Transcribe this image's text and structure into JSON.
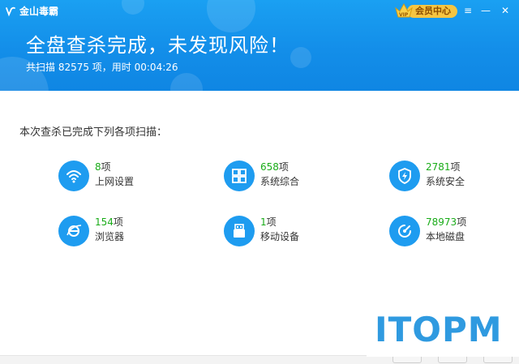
{
  "app": {
    "title": "金山毒霸"
  },
  "header": {
    "vip_label": "会员中心",
    "headline": "全盘查杀完成，未发现风险！",
    "summary": "共扫描 82575 项，用时 00:04:26"
  },
  "window_controls": {
    "menu": "≡",
    "minimize": "—",
    "close": "✕"
  },
  "main": {
    "section_title": "本次查杀已完成下列各项扫描：",
    "items": [
      {
        "count": "8",
        "unit": "项",
        "label": "上网设置",
        "icon": "wifi-icon"
      },
      {
        "count": "658",
        "unit": "项",
        "label": "系统综合",
        "icon": "grid-icon"
      },
      {
        "count": "2781",
        "unit": "项",
        "label": "系统安全",
        "icon": "shield-icon"
      },
      {
        "count": "154",
        "unit": "项",
        "label": "浏览器",
        "icon": "ie-browser-icon"
      },
      {
        "count": "1",
        "unit": "项",
        "label": "移动设备",
        "icon": "usb-icon"
      },
      {
        "count": "78973",
        "unit": "项",
        "label": "本地磁盘",
        "icon": "disk-icon"
      }
    ]
  },
  "watermark": {
    "text": "ITOPM"
  },
  "colors": {
    "header": "#138ee9",
    "icon_bg": "#1e9cf0",
    "count": "#1aac19"
  }
}
